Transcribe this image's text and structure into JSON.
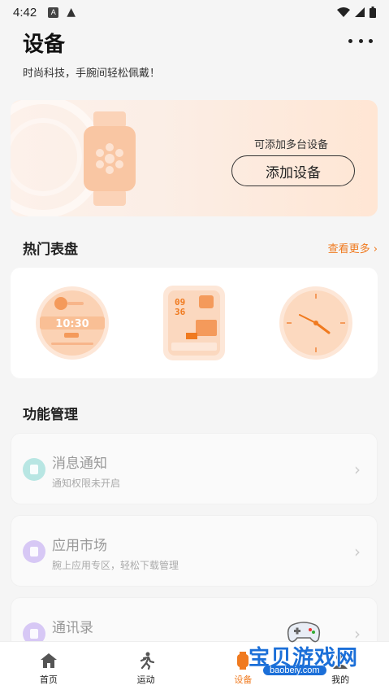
{
  "status_bar": {
    "time": "4:42",
    "icons": [
      "a-icon",
      "warning-icon",
      "wifi-icon",
      "signal-icon",
      "battery-icon"
    ]
  },
  "header": {
    "title": "设备",
    "subtitle": "时尚科技，手腕间轻松佩戴！"
  },
  "banner": {
    "hint": "可添加多台设备",
    "add_button": "添加设备"
  },
  "hot_dials": {
    "title": "热门表盘",
    "see_more": "查看更多 ›",
    "dial1_time": "10:30",
    "dial2_hour": "09",
    "dial2_min": "36"
  },
  "functions": {
    "title": "功能管理",
    "items": [
      {
        "title": "消息通知",
        "desc": "通知权限未开启",
        "icon_color": "#b8e6e3"
      },
      {
        "title": "应用市场",
        "desc": "腕上应用专区，轻松下载管理",
        "icon_color": "#d7c8f5"
      },
      {
        "title": "通讯录",
        "desc": "",
        "icon_color": "#d7c8f5"
      }
    ]
  },
  "bottom_nav": {
    "items": [
      {
        "label": "首页"
      },
      {
        "label": "运动"
      },
      {
        "label": "设备",
        "active": true
      },
      {
        "label": "我的"
      }
    ]
  },
  "watermark": {
    "text": "宝贝游戏网",
    "url": "baobeiy.com"
  },
  "colors": {
    "accent": "#f07a1f",
    "banner_bg": "#fdf1ea"
  }
}
